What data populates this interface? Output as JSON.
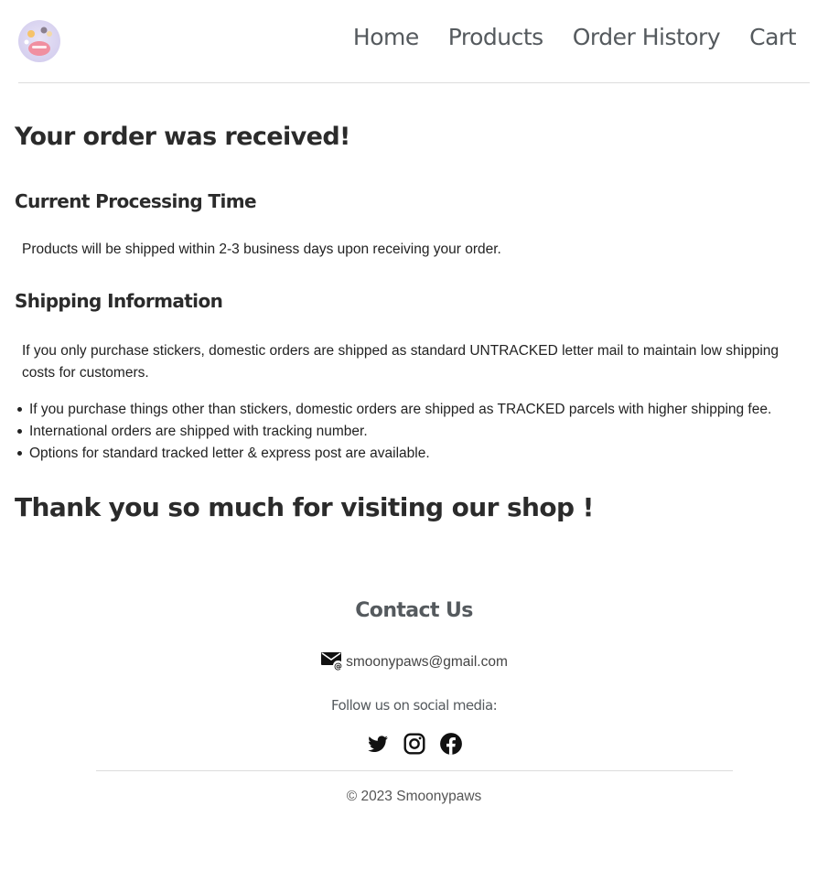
{
  "header": {
    "logo_icon": "smoonypaws-logo-icon",
    "nav": [
      {
        "label": "Home"
      },
      {
        "label": "Products"
      },
      {
        "label": "Order History"
      },
      {
        "label": "Cart"
      }
    ]
  },
  "main": {
    "title": "Your order was received!",
    "processing": {
      "heading": "Current Processing Time",
      "text": "Products will be shipped within 2-3 business days upon receiving your order."
    },
    "shipping": {
      "heading": "Shipping Information",
      "text": "If you only purchase stickers, domestic orders are shipped as standard UNTRACKED letter mail to maintain low shipping costs for customers.",
      "bullets": [
        "If you purchase things other than stickers, domestic orders are shipped as TRACKED parcels with higher shipping fee.",
        "International orders are shipped with tracking number.",
        "Options for standard tracked letter & express post are available."
      ]
    },
    "thanks": "Thank you so much for visiting our shop !"
  },
  "footer": {
    "contact_heading": "Contact Us",
    "email_icon": "email-icon",
    "email": "smoonypaws@gmail.com",
    "follow_text": "Follow us on social media:",
    "social_icons": [
      "twitter-icon",
      "instagram-icon",
      "facebook-icon"
    ],
    "copyright": "© 2023 Smoonypaws"
  }
}
